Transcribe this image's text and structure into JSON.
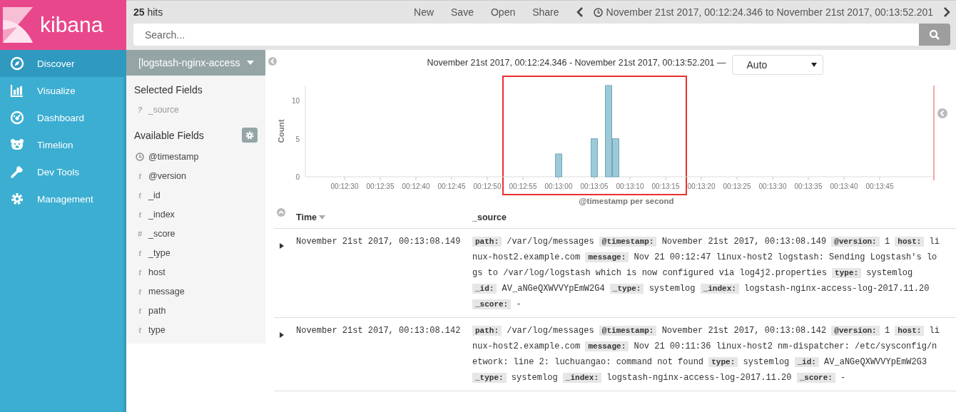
{
  "brand": {
    "name": "kibana"
  },
  "nav": [
    {
      "label": "Discover",
      "selected": true
    },
    {
      "label": "Visualize",
      "selected": false
    },
    {
      "label": "Dashboard",
      "selected": false
    },
    {
      "label": "Timelion",
      "selected": false
    },
    {
      "label": "Dev Tools",
      "selected": false
    },
    {
      "label": "Management",
      "selected": false
    }
  ],
  "top": {
    "hits_count": "25",
    "hits_label": "hits",
    "actions": [
      "New",
      "Save",
      "Open",
      "Share"
    ],
    "time_range": "November 21st 2017, 00:12:24.346 to November 21st 2017, 00:13:52.201"
  },
  "search": {
    "placeholder": "Search..."
  },
  "index_pattern": "[logstash-nginx-access",
  "selected_fields": {
    "title": "Selected Fields",
    "items": [
      {
        "kind": "text",
        "type": "?",
        "name": "_source"
      }
    ]
  },
  "available_fields": {
    "title": "Available Fields",
    "items": [
      {
        "kind": "date",
        "name": "@timestamp"
      },
      {
        "kind": "text",
        "type": "t",
        "name": "@version"
      },
      {
        "kind": "text",
        "type": "t",
        "name": "_id"
      },
      {
        "kind": "text",
        "type": "t",
        "name": "_index"
      },
      {
        "kind": "text",
        "type": "#",
        "name": "_score"
      },
      {
        "kind": "text",
        "type": "t",
        "name": "_type"
      },
      {
        "kind": "text",
        "type": "t",
        "name": "host"
      },
      {
        "kind": "text",
        "type": "t",
        "name": "message"
      },
      {
        "kind": "text",
        "type": "t",
        "name": "path"
      },
      {
        "kind": "text",
        "type": "t",
        "name": "type"
      }
    ]
  },
  "histogram": {
    "range": "November 21st 2017, 00:12:24.346 - November 21st 2017, 00:13:52.201 —",
    "interval": "Auto",
    "highlight_frame": true,
    "chart_data": {
      "type": "bar",
      "xlabel": "@timestamp per second",
      "ylabel": "Count",
      "ylim": [
        0,
        12
      ],
      "yticks": [
        0,
        5,
        10
      ],
      "categories": [
        null,
        null,
        null,
        null,
        null,
        "00:12:30",
        null,
        null,
        null,
        null,
        "00:12:35",
        null,
        null,
        null,
        null,
        "00:12:40",
        null,
        null,
        null,
        null,
        "00:12:45",
        null,
        null,
        null,
        null,
        "00:12:50",
        null,
        null,
        null,
        null,
        "00:12:55",
        null,
        null,
        null,
        null,
        "00:13:00",
        null,
        null,
        null,
        null,
        "00:13:05",
        null,
        null,
        null,
        null,
        "00:13:10",
        null,
        null,
        null,
        null,
        "00:13:15",
        null,
        null,
        null,
        null,
        "00:13:20",
        null,
        null,
        null,
        null,
        "00:13:25",
        null,
        null,
        null,
        null,
        "00:13:30",
        null,
        null,
        null,
        null,
        "00:13:35",
        null,
        null,
        null,
        null,
        "00:13:40",
        null,
        null,
        null,
        null,
        "00:13:45",
        null,
        null,
        null,
        null,
        null,
        null,
        null
      ],
      "series": [
        {
          "color": "#9ecad8",
          "values": [
            null,
            null,
            null,
            null,
            null,
            null,
            null,
            null,
            null,
            null,
            null,
            null,
            null,
            null,
            null,
            null,
            null,
            null,
            null,
            null,
            null,
            null,
            null,
            null,
            null,
            null,
            null,
            null,
            null,
            null,
            null,
            null,
            null,
            null,
            null,
            3,
            null,
            null,
            null,
            null,
            5,
            null,
            12,
            5,
            null,
            null,
            null,
            null,
            null,
            null,
            null,
            null,
            null,
            null,
            null,
            null,
            null,
            null,
            null,
            null,
            null,
            null,
            null,
            null,
            null,
            null,
            null,
            null,
            null,
            null,
            null,
            null,
            null,
            null,
            null,
            null,
            null,
            null,
            null,
            null,
            null,
            null,
            null,
            null,
            null,
            null,
            null,
            null
          ]
        }
      ]
    }
  },
  "table": {
    "columns": [
      {
        "label": "Time",
        "sorted": true
      },
      {
        "label": "_source",
        "sorted": false
      }
    ],
    "rows": [
      {
        "time": "November 21st 2017, 00:13:08.149",
        "fields": [
          {
            "key": "path:",
            "value": "/var/log/messages"
          },
          {
            "key": "@timestamp:",
            "value": "November 21st 2017, 00:13:08.149"
          },
          {
            "key": "@version:",
            "value": "1"
          },
          {
            "key": "host:",
            "value": "linux-host2.example.com"
          },
          {
            "key": "message:",
            "value": "Nov 21 00:12:47 linux-host2 logstash: Sending Logstash's logs to /var/log/logstash which is now configured via log4j2.properties"
          },
          {
            "key": "type:",
            "value": "systemlog"
          },
          {
            "key": "_id:",
            "value": "AV_aNGeQXWVVYpEmW2G4"
          },
          {
            "key": "_type:",
            "value": "systemlog"
          },
          {
            "key": "_index:",
            "value": "logstash-nginx-access-log-2017.11.20"
          },
          {
            "key": "_score:",
            "value": "-"
          }
        ]
      },
      {
        "time": "November 21st 2017, 00:13:08.142",
        "fields": [
          {
            "key": "path:",
            "value": "/var/log/messages"
          },
          {
            "key": "@timestamp:",
            "value": "November 21st 2017, 00:13:08.142"
          },
          {
            "key": "@version:",
            "value": "1"
          },
          {
            "key": "host:",
            "value": "linux-host2.example.com"
          },
          {
            "key": "message:",
            "value": "Nov 21 00:11:36 linux-host2 nm-dispatcher: /etc/sysconfig/network: line 2: luchuangao: command not found"
          },
          {
            "key": "type:",
            "value": "systemlog"
          },
          {
            "key": "_id:",
            "value": "AV_aNGeQXWVVYpEmW2G3"
          },
          {
            "key": "_type:",
            "value": "systemlog"
          },
          {
            "key": "_index:",
            "value": "logstash-nginx-access-log-2017.11.20"
          },
          {
            "key": "_score:",
            "value": "-"
          }
        ]
      }
    ]
  }
}
